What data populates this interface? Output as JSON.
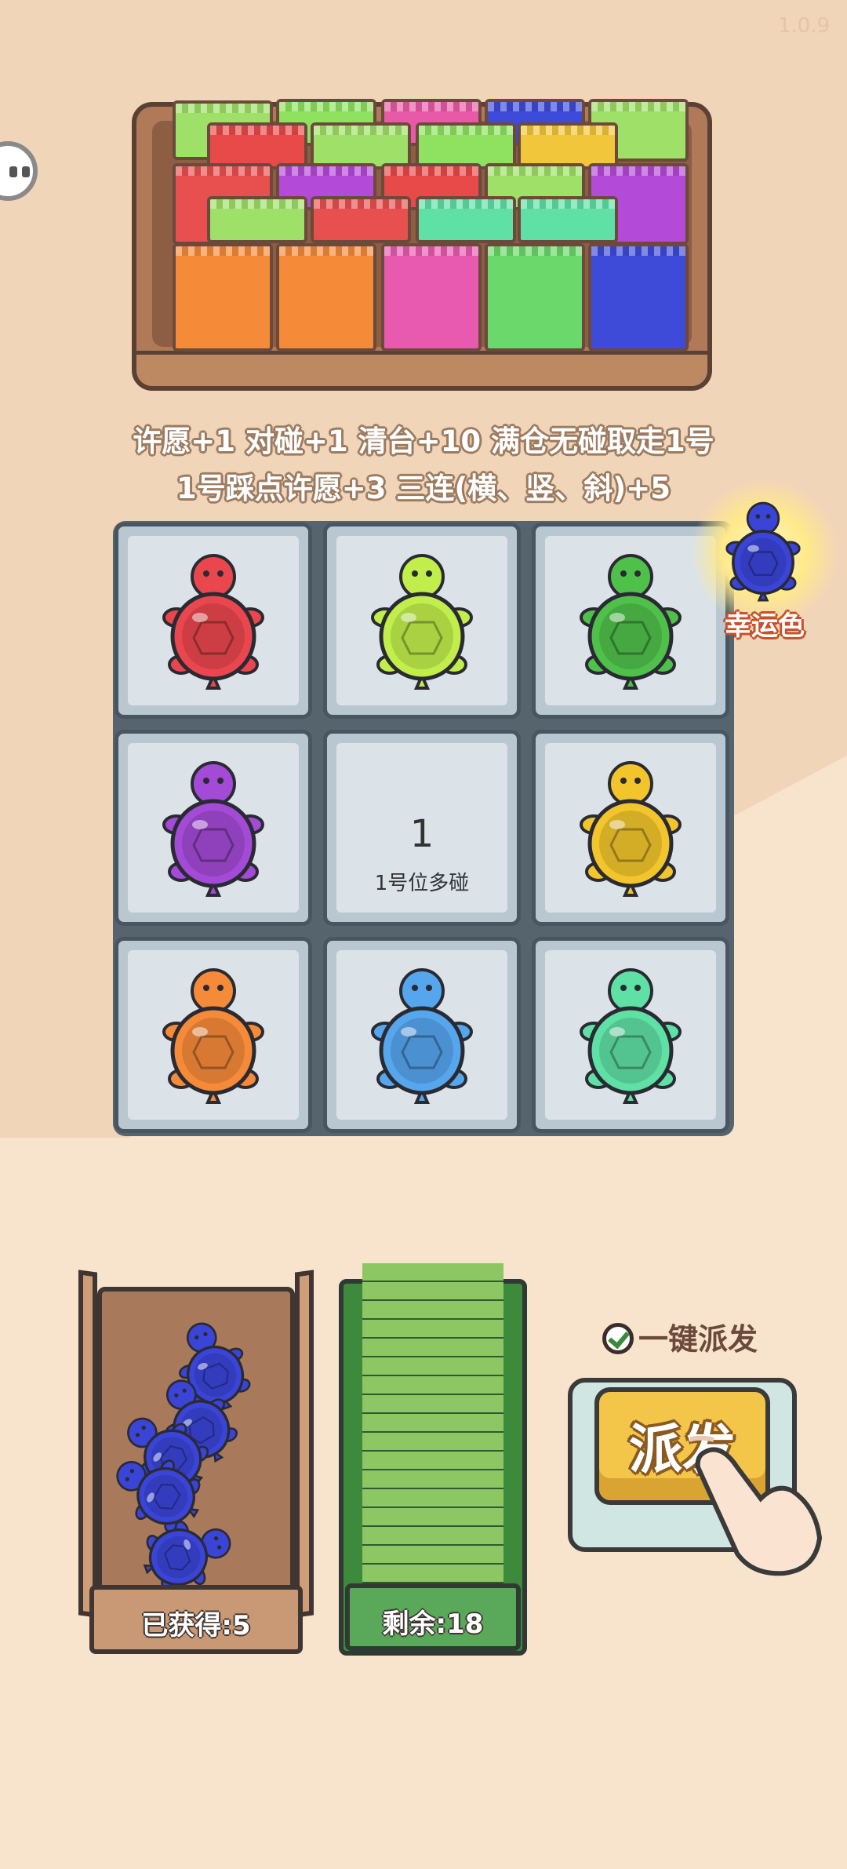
{
  "version": "1.0.9",
  "rules": {
    "line1": "许愿+1 对碰+1 清台+10 满仓无碰取走1号",
    "line2": "1号踩点许愿+3 三连(横、竖、斜)+5"
  },
  "board": {
    "cells": [
      {
        "color": "#e9474d",
        "label": "red-turtle"
      },
      {
        "color": "#c1ee4a",
        "label": "lime-turtle"
      },
      {
        "color": "#4fc04a",
        "label": "green-turtle"
      },
      {
        "color": "#a34ad6",
        "label": "purple-turtle"
      },
      {
        "center_number": "1",
        "center_text": "1号位多碰"
      },
      {
        "color": "#f2c52c",
        "label": "yellow-turtle"
      },
      {
        "color": "#f58a39",
        "label": "orange-turtle"
      },
      {
        "color": "#56a6ee",
        "label": "lightblue-turtle"
      },
      {
        "color": "#5fe0a4",
        "label": "mint-turtle"
      }
    ]
  },
  "lucky": {
    "label": "幸运色",
    "color": "#3a45d8"
  },
  "collected": {
    "label": "已获得:5",
    "count": 5,
    "color": "#3a45d8"
  },
  "remaining": {
    "label": "剩余:18",
    "count": 18
  },
  "auto_dispatch": {
    "label": "一键派发",
    "checked": true
  },
  "dispatch_button": {
    "label": "派发"
  },
  "colors": {
    "bg": "#f1d5b8",
    "accent": "#f3c64a"
  }
}
